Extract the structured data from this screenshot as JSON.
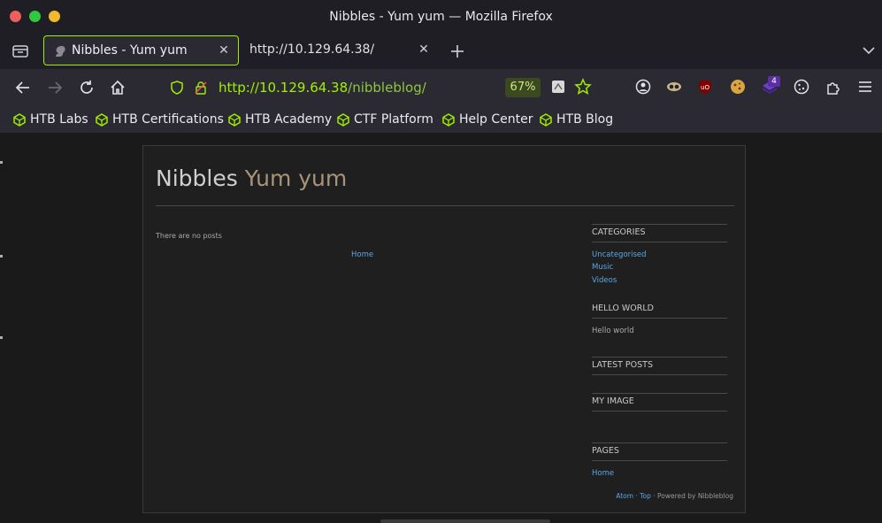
{
  "window": {
    "title": "Nibbles - Yum yum — Mozilla Firefox"
  },
  "tabs": [
    {
      "label": "Nibbles - Yum yum",
      "active": true
    },
    {
      "label": "http://10.129.64.38/",
      "active": false
    }
  ],
  "urlbar": {
    "scheme": "http://",
    "host": "10.129.64.38",
    "path": "/nibbleblog/",
    "zoom": "67%"
  },
  "extensions": {
    "badge_count": "4"
  },
  "bookmarks": [
    {
      "label": "HTB Labs"
    },
    {
      "label": "HTB Certifications"
    },
    {
      "label": "HTB Academy"
    },
    {
      "label": "CTF Platform"
    },
    {
      "label": "Help Center"
    },
    {
      "label": "HTB Blog"
    }
  ],
  "blog": {
    "name": "Nibbles",
    "slogan": "Yum yum",
    "no_posts": "There are no posts",
    "home_link": "Home",
    "sidebar": {
      "categories_title": "CATEGORIES",
      "categories": [
        "Uncategorised",
        "Music",
        "Videos"
      ],
      "hello_title": "HELLO WORLD",
      "hello_text": "Hello world",
      "latest_title": "LATEST POSTS",
      "image_title": "MY IMAGE",
      "pages_title": "PAGES",
      "pages": [
        "Home"
      ]
    },
    "footer": {
      "atom": "Atom",
      "sep1": " · ",
      "top": "Top",
      "powered": " · Powered by Nibbleblog"
    }
  },
  "colors": {
    "accent": "#9fef00",
    "link": "#5aa7e6",
    "slogan": "#a89478"
  }
}
